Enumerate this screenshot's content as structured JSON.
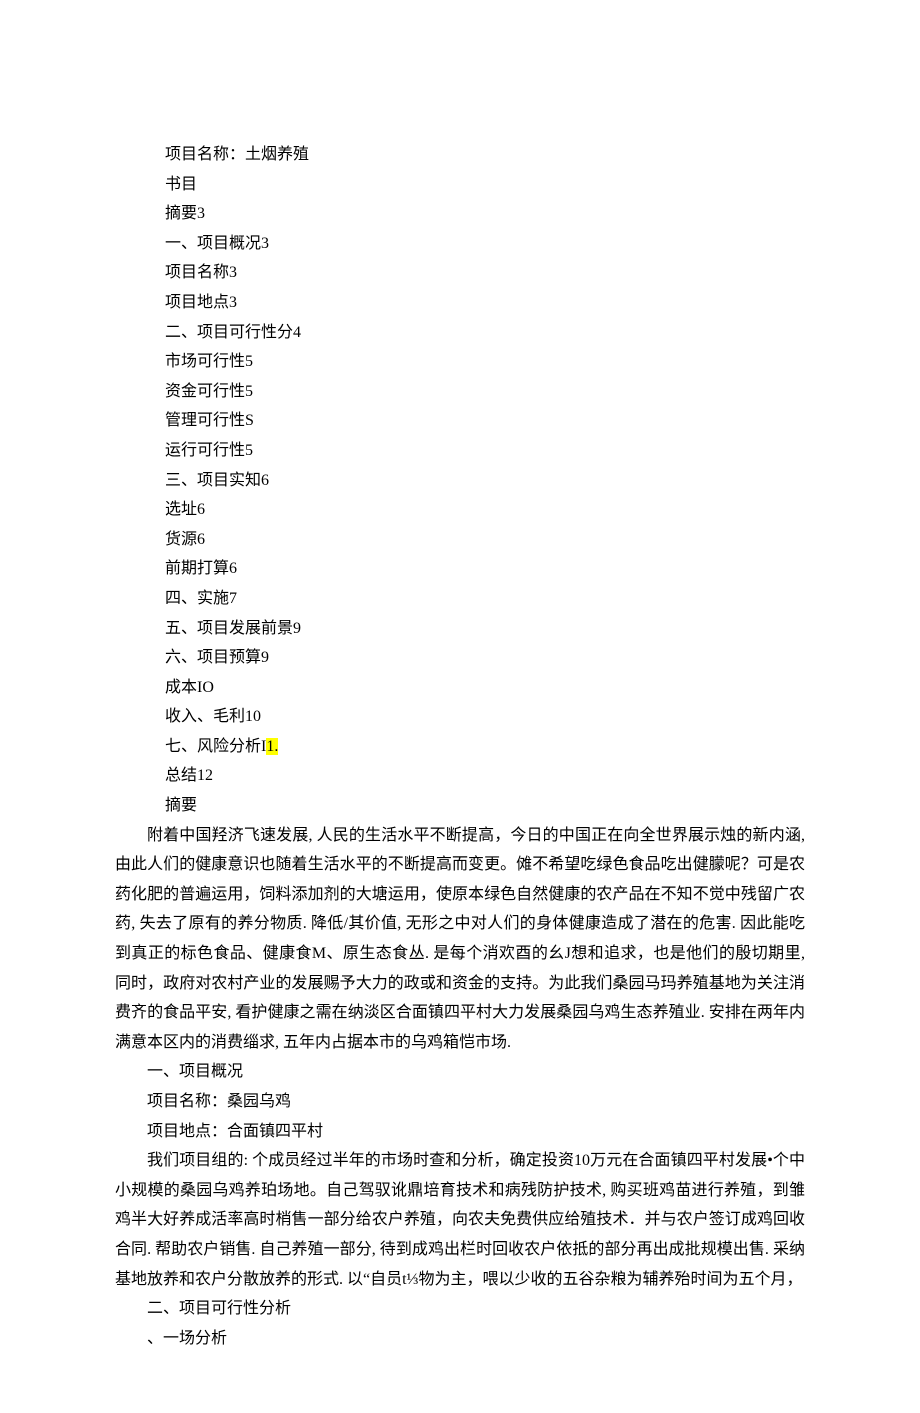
{
  "toc": [
    "项目名称：土烟养殖",
    "书目",
    "摘要3",
    "一、项目概况3",
    "项目名称3",
    "项目地点3",
    "二、项目可行性分4",
    "市场可行性5",
    "资金可行性5",
    "管理可行性S",
    "运行可行性5",
    "三、项目实知6",
    "选址6",
    "货源6",
    "前期打算6",
    "四、实施7",
    "五、项目发展前景9",
    "六、项目预算9",
    "成本IO",
    "收入、毛利10",
    "七、风险分析I",
    "总结12",
    "摘要"
  ],
  "toc_highlight_suffix": "1.",
  "abstract": "附着中国羟济飞速发展, 人民的生活水平不断提高，今日的中国正在向全世界展示烛的新内涵, 由此人们的健康意识也随着生活水平的不断提高而变更。傩不希望吃绿色食品吃出健朦呢？可是农药化肥的普遍运用，饲料添加剂的大塘运用，使原本绿色自然健康的农产品在不知不觉中残留广农药, 失去了原有的养分物质. 降低/其价值, 无形之中对人们的身体健康造成了潜在的危害. 因此能吃到真正的标色食品、健康食M、原生态食丛. 是每个消欢酉的幺J想和追求，也是他们的殷切期里, 同时，政府对农村产业的发展赐予大力的政或和资金的支持。为此我们桑园马玛养殖基地为关注消费齐的食品平安, 看护健康之需在纳淡区合面镇四平村大力发展桑园乌鸡生态养殖业. 安排在两年内满意本区内的消费缁求, 五年内占据本市的乌鸡箱恺市场.",
  "section1": {
    "heading": "一、项目概况",
    "name_line": "项目名称：桑园乌鸡",
    "location_line": "项目地点：合面镇四平村",
    "para": "我们项目组的: 个成员经过半年的市场时查和分析，确定投资10万元在合面镇四平村发展•个中小规模的桑园乌鸡养珀场地。自己驾驭讹鼎培育技术和病残防护技术, 购买班鸡苗进行养殖，到雏鸡半大好养成活率高时梢售一部分给农户养殖，向农夫免费供应给殖技术．并与农户签订成鸡回收合同. 帮助农户销售. 自己养殖一部分, 待到成鸡出栏时回收农户依抵的部分再出成批规模出售. 采纳基地放养和农户分散放养的形式. 以“自员t⅓物为主，喂以少收的五谷杂粮为辅养殆时间为五个月，"
  },
  "section2": {
    "heading": "二、项目可行性分析",
    "sub": "、一场分析"
  }
}
